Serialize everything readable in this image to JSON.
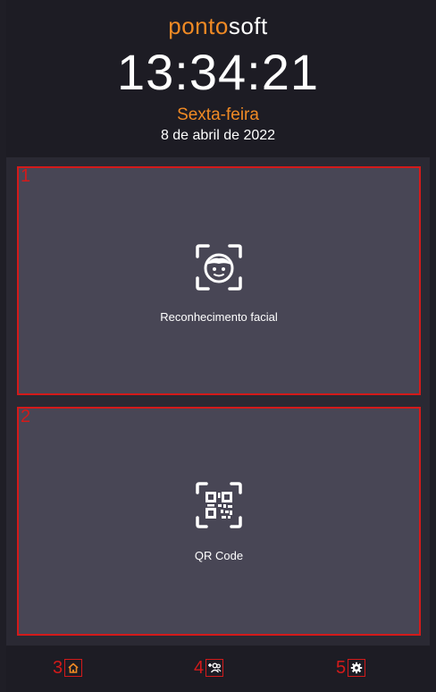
{
  "header": {
    "logo_part1": "ponto",
    "logo_part2": "soft",
    "time": "13:34:21",
    "weekday": "Sexta-feira",
    "date": "8 de abril de 2022"
  },
  "options": [
    {
      "number": "1",
      "label": "Reconhecimento facial",
      "icon": "face-recognition-icon"
    },
    {
      "number": "2",
      "label": "QR Code",
      "icon": "qr-code-icon"
    }
  ],
  "nav": [
    {
      "number": "3",
      "icon": "home-icon"
    },
    {
      "number": "4",
      "icon": "add-user-icon"
    },
    {
      "number": "5",
      "icon": "gear-icon"
    }
  ],
  "colors": {
    "accent": "#f08a24",
    "annotation": "#d31a1a",
    "panel": "#484655",
    "background": "#1d1c24"
  }
}
